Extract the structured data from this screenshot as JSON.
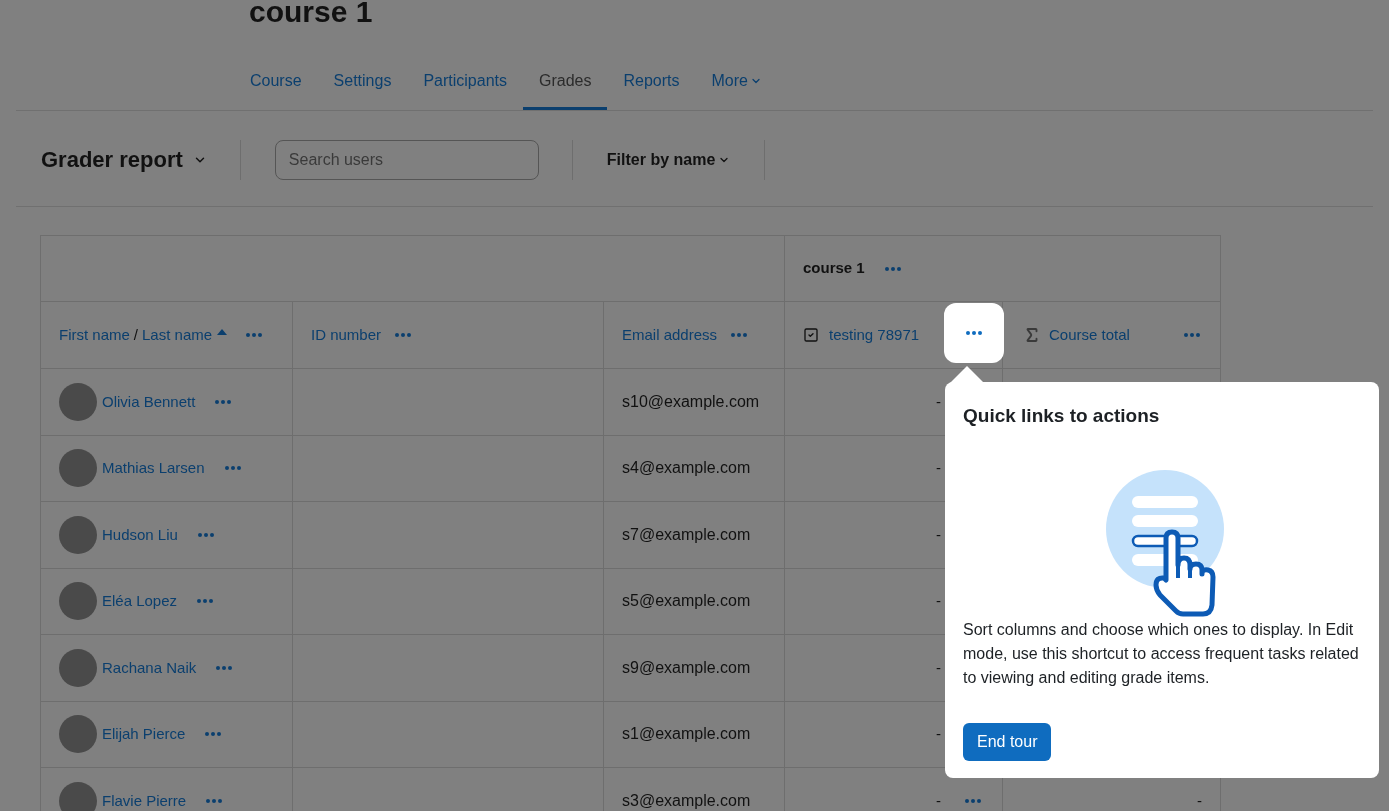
{
  "course_title": "course 1",
  "nav_tabs": [
    {
      "label": "Course",
      "selected": false,
      "menu": false
    },
    {
      "label": "Settings",
      "selected": false,
      "menu": false
    },
    {
      "label": "Participants",
      "selected": false,
      "menu": false
    },
    {
      "label": "Grades",
      "selected": true,
      "menu": false
    },
    {
      "label": "Reports",
      "selected": false,
      "menu": false
    },
    {
      "label": "More",
      "selected": false,
      "menu": true
    }
  ],
  "report": {
    "title": "Grader report",
    "search": {
      "placeholder": "Search users"
    },
    "filter": "Filter by name"
  },
  "table": {
    "group_header": "course 1",
    "columns": [
      {
        "kind": "name",
        "first": "First name",
        "separator": "/",
        "last": "Last name",
        "sorted": true
      },
      {
        "kind": "text",
        "label": "ID number"
      },
      {
        "kind": "text",
        "label": "Email address"
      },
      {
        "kind": "grade_item",
        "label": "testing 78971"
      },
      {
        "kind": "total",
        "label": "Course total"
      }
    ],
    "rows": [
      {
        "name": "Olivia Bennett",
        "email": "s10@example.com",
        "grade": "-"
      },
      {
        "name": "Mathias Larsen",
        "email": "s4@example.com",
        "grade": "-"
      },
      {
        "name": "Hudson Liu",
        "email": "s7@example.com",
        "grade": "-"
      },
      {
        "name": "Eléa Lopez",
        "email": "s5@example.com",
        "grade": "-"
      },
      {
        "name": "Rachana Naik",
        "email": "s9@example.com",
        "grade": "-"
      },
      {
        "name": "Elijah Pierce",
        "email": "s1@example.com",
        "grade": "-"
      },
      {
        "name": "Flavie Pierre",
        "email": "s3@example.com",
        "grade": "-",
        "total": "-"
      }
    ]
  },
  "tour": {
    "title": "Quick links to actions",
    "body": "Sort columns and choose which ones to display. In Edit mode, use this shortcut to access frequent tasks related to viewing and editing grade items.",
    "button": "End tour"
  }
}
